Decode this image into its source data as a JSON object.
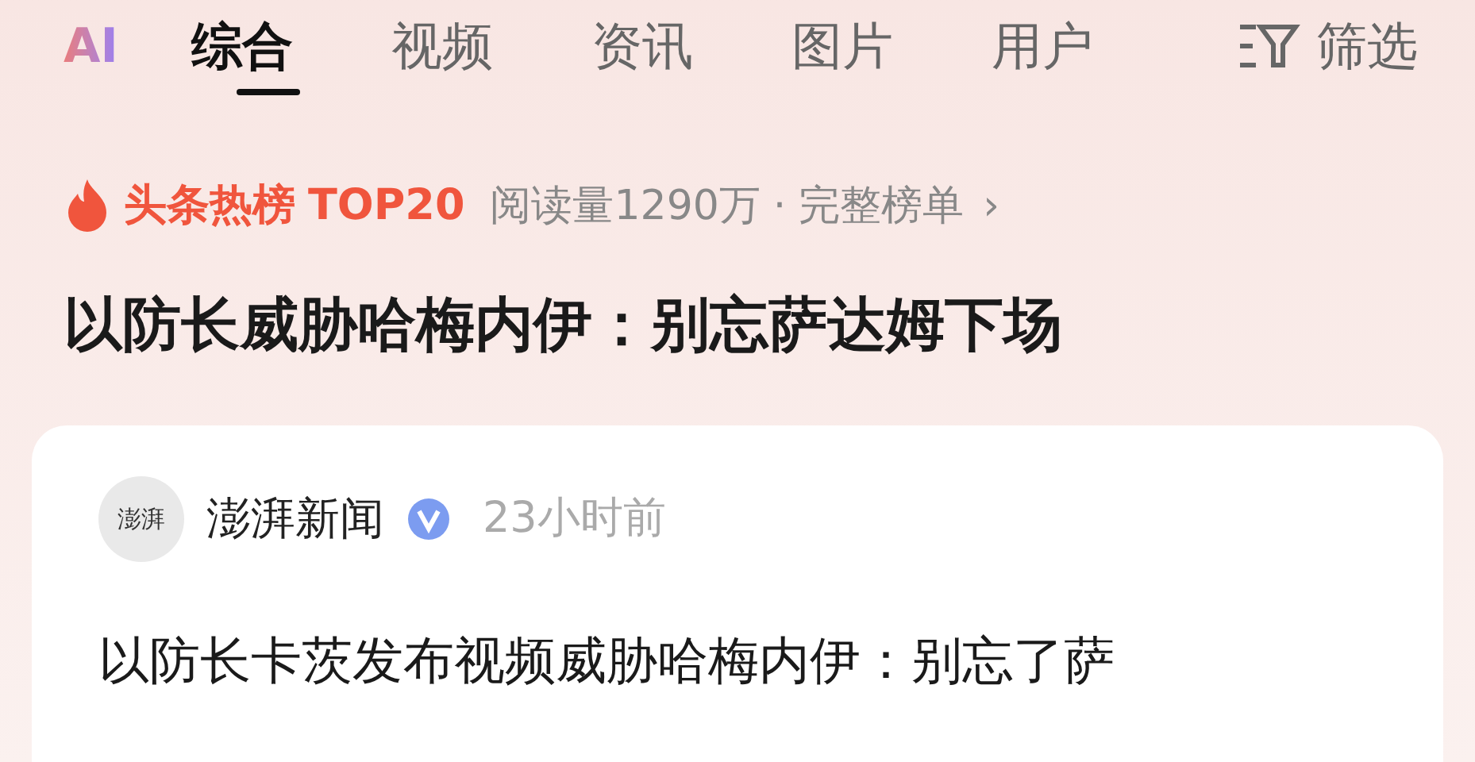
{
  "logo": "AI",
  "tabs": [
    {
      "label": "综合",
      "selected": true
    },
    {
      "label": "视频",
      "selected": false
    },
    {
      "label": "资讯",
      "selected": false
    },
    {
      "label": "图片",
      "selected": false
    },
    {
      "label": "用户",
      "selected": false
    }
  ],
  "filter": {
    "label": "筛选"
  },
  "hot_list": {
    "label": "头条热榜",
    "rank": "TOP20",
    "reads": "阅读量1290万",
    "separator": "·",
    "link": "完整榜单",
    "chevron": "›"
  },
  "headline": "以防长威胁哈梅内伊：别忘萨达姆下场",
  "card": {
    "avatar": "澎湃",
    "source": "澎湃新闻",
    "verified": true,
    "time": "23小时前",
    "text": "以防长卡茨发布视频威胁哈梅内伊：别忘了萨"
  }
}
